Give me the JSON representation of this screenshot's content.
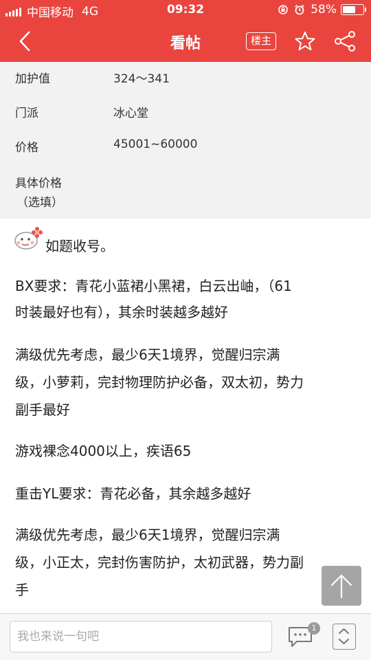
{
  "status_bar": {
    "carrier": "中国移动",
    "network": "4G",
    "time": "09:32",
    "battery": "58%"
  },
  "nav": {
    "title": "看帖",
    "owner_label": "楼主",
    "accent_color": "#e9453e"
  },
  "info": [
    {
      "label": "加护值",
      "value": "324～341"
    },
    {
      "label": "门派",
      "value": "冰心堂"
    },
    {
      "label": "价格",
      "value": "45001~60000"
    },
    {
      "label": "具体价格",
      "label_extra": "（选填）",
      "value": ""
    }
  ],
  "post": {
    "lines": [
      "如题收号。",
      " BX要求：青花小蓝裙小黑裙，白云出岫，（61",
      "时装最好也有），其余时装越多越好",
      "  满级优先考虑，最少6天1境界，觉醒归宗满",
      "级，小萝莉，完封物理防护必备，双太初，势力",
      "副手最好",
      "  游戏裸念4000以上，疾语65",
      "重击YL要求：青花必备，其余越多越好",
      "    满级优先考虑，最少6天1境界，觉醒归宗满",
      "级，小正太，完封伤害防护，太初武器，势力副",
      "手"
    ]
  },
  "bottom": {
    "reply_placeholder": "我也来说一句吧",
    "comment_count": "1"
  },
  "icons": {
    "back": "chevron-left-icon",
    "star": "star-icon",
    "share": "share-icon",
    "scroll_top": "arrow-up-icon",
    "comment": "comment-icon",
    "page": "page-updown-icon",
    "emoji": "smiley-emoji-icon"
  }
}
